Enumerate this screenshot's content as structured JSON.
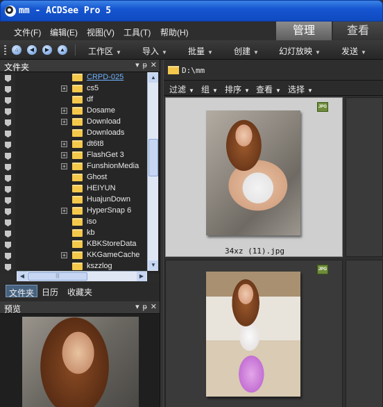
{
  "window": {
    "title": "mm - ACDSee Pro 5"
  },
  "menu": [
    "文件(F)",
    "编辑(E)",
    "视图(V)",
    "工具(T)",
    "帮助(H)"
  ],
  "modes": {
    "manage": "管理",
    "view": "查看"
  },
  "toolbar": {
    "items": [
      "工作区",
      "导入",
      "批量",
      "创建",
      "幻灯放映",
      "发送"
    ]
  },
  "folders_pane": {
    "title": "文件夹",
    "controls": [
      "▾",
      "ᵽ",
      "✕"
    ],
    "items": [
      {
        "name": "CRPD-025",
        "expandable": false,
        "selected": true
      },
      {
        "name": "cs5",
        "expandable": true
      },
      {
        "name": "df",
        "expandable": false
      },
      {
        "name": "Dosame",
        "expandable": true
      },
      {
        "name": "Download",
        "expandable": true
      },
      {
        "name": "Downloads",
        "expandable": false
      },
      {
        "name": "dt6t8",
        "expandable": true
      },
      {
        "name": "FlashGet 3",
        "expandable": true
      },
      {
        "name": "FunshionMedia",
        "expandable": true
      },
      {
        "name": "Ghost",
        "expandable": false
      },
      {
        "name": "HEIYUN",
        "expandable": false
      },
      {
        "name": "HuajunDown",
        "expandable": false
      },
      {
        "name": "HyperSnap 6",
        "expandable": true
      },
      {
        "name": "iso",
        "expandable": false
      },
      {
        "name": "kb",
        "expandable": false
      },
      {
        "name": "KBKStoreData",
        "expandable": false
      },
      {
        "name": "KKGameCache",
        "expandable": true
      },
      {
        "name": "kszzlog",
        "expandable": false
      }
    ]
  },
  "pane_tabs": [
    "文件夹",
    "日历",
    "收藏夹"
  ],
  "preview_pane": {
    "title": "预览",
    "controls": [
      "▾",
      "ᵽ",
      "✕"
    ]
  },
  "file_browser": {
    "path": "D:\\mm",
    "filters": [
      "过滤",
      "组",
      "排序",
      "查看",
      "选择"
    ],
    "files": [
      {
        "name": "34xz (11).jpg",
        "badge": "JPG",
        "selected": true
      },
      {
        "name": "",
        "badge": "JPG",
        "selected": false
      }
    ]
  },
  "icons": {
    "nav": [
      "home-icon",
      "back-icon",
      "forward-icon",
      "up-icon"
    ]
  },
  "colors": {
    "titlebar": "#1656d1",
    "selection_link": "#6fb3ff",
    "active_tab": "#46627f"
  }
}
